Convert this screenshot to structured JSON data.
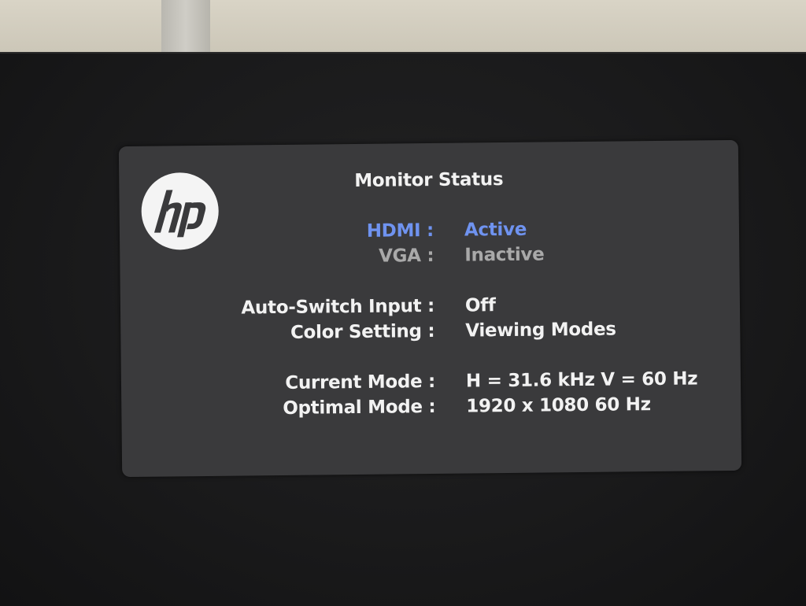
{
  "osd": {
    "title": "Monitor Status",
    "logo_text": "hp",
    "inputs": [
      {
        "label": "HDMI :",
        "value": "Active",
        "state": "active"
      },
      {
        "label": "VGA :",
        "value": "Inactive",
        "state": "inactive"
      }
    ],
    "settings": [
      {
        "label": "Auto-Switch Input :",
        "value": "Off"
      },
      {
        "label": "Color Setting :",
        "value": "Viewing Modes"
      }
    ],
    "modes": [
      {
        "label": "Current Mode :",
        "value": "H = 31.6 kHz  V = 60 Hz"
      },
      {
        "label": "Optimal Mode :",
        "value": "1920 x 1080  60 Hz"
      }
    ],
    "colors": {
      "active": "#6f93f0",
      "inactive": "#a9a9a9",
      "text": "#f2f2f2",
      "panel": "#3a3a3c"
    }
  }
}
